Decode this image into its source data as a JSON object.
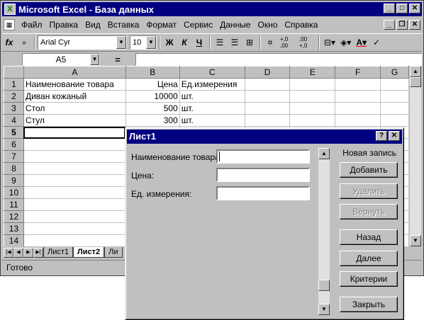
{
  "window": {
    "title": "Microsoft Excel - База данных"
  },
  "menu": [
    "Файл",
    "Правка",
    "Вид",
    "Вставка",
    "Формат",
    "Сервис",
    "Данные",
    "Окно",
    "Справка"
  ],
  "toolbar": {
    "font": "Arial Cyr",
    "size": "10",
    "bold": "Ж",
    "italic": "К",
    "underline": "Ч",
    "fx": "fx",
    "chevron": "»",
    "inc_decimal": "+,0 ,00",
    "dec_decimal": ",00 +,0"
  },
  "formula": {
    "namebox": "A5",
    "eq": "="
  },
  "columns": [
    "A",
    "B",
    "C",
    "D",
    "E",
    "F",
    "G"
  ],
  "rows": [
    {
      "n": "1",
      "a": "Наименование товара",
      "b": "Цена",
      "c": "Ед.измерения"
    },
    {
      "n": "2",
      "a": "Диван кожаный",
      "b": "10000",
      "c": "шт."
    },
    {
      "n": "3",
      "a": "Стол",
      "b": "500",
      "c": "шт."
    },
    {
      "n": "4",
      "a": "Стул",
      "b": "300",
      "c": "шт."
    },
    {
      "n": "5",
      "a": "",
      "b": "",
      "c": ""
    },
    {
      "n": "6",
      "a": "",
      "b": "",
      "c": ""
    },
    {
      "n": "7",
      "a": "",
      "b": "",
      "c": ""
    },
    {
      "n": "8",
      "a": "",
      "b": "",
      "c": ""
    },
    {
      "n": "9",
      "a": "",
      "b": "",
      "c": ""
    },
    {
      "n": "10",
      "a": "",
      "b": "",
      "c": ""
    },
    {
      "n": "11",
      "a": "",
      "b": "",
      "c": ""
    },
    {
      "n": "12",
      "a": "",
      "b": "",
      "c": ""
    },
    {
      "n": "13",
      "a": "",
      "b": "",
      "c": ""
    },
    {
      "n": "14",
      "a": "",
      "b": "",
      "c": ""
    }
  ],
  "tabs": {
    "sheet1": "Лист1",
    "sheet2": "Лист2",
    "sheet3": "Ли"
  },
  "status": "Готово",
  "dialog": {
    "title": "Лист1",
    "help": "?",
    "close": "✕",
    "fields": {
      "name": "Наименование товара:",
      "price": "Цена:",
      "unit": "Ед. измерения:"
    },
    "record_info": "Новая запись",
    "buttons": {
      "add": "Добавить",
      "delete": "Удалить",
      "restore": "Вернуть",
      "prev": "Назад",
      "next": "Далее",
      "criteria": "Критерии",
      "close": "Закрыть"
    }
  }
}
